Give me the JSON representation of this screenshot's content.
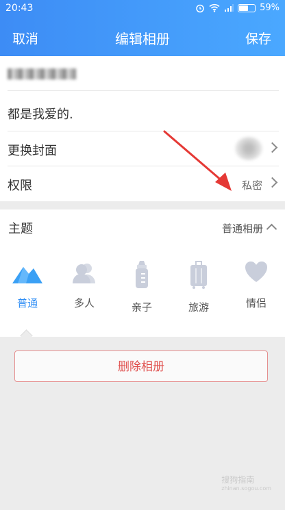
{
  "status": {
    "time": "20:43",
    "battery": "59%"
  },
  "nav": {
    "cancel": "取消",
    "title": "编辑相册",
    "save": "保存"
  },
  "album": {
    "description": "都是我爱的."
  },
  "rows": {
    "cover_label": "更换封面",
    "permission_label": "权限",
    "permission_value": "私密"
  },
  "theme": {
    "label": "主题",
    "selected_value": "普通相册",
    "items": [
      {
        "label": "普通",
        "icon": "mountain-icon"
      },
      {
        "label": "多人",
        "icon": "people-icon"
      },
      {
        "label": "亲子",
        "icon": "baby-bottle-icon"
      },
      {
        "label": "旅游",
        "icon": "suitcase-icon"
      },
      {
        "label": "情侣",
        "icon": "heart-icon"
      }
    ]
  },
  "delete_label": "删除相册",
  "watermark": {
    "text": "搜狗指南",
    "sub": "zhinan.sogou.com"
  },
  "colors": {
    "accent": "#2f8ef5",
    "danger": "#e0504e",
    "annotation": "#e53935"
  }
}
